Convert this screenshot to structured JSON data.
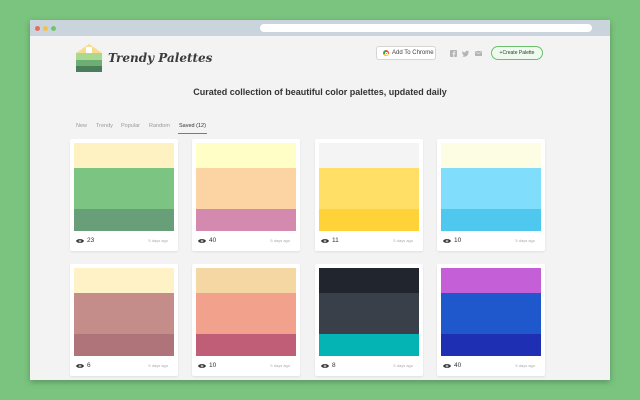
{
  "brand": {
    "name": "Trendy Palettes"
  },
  "header": {
    "chrome_button_label": "Add To Chrome",
    "create_button_label": "+Create Palette",
    "social_icons": [
      "facebook-icon",
      "twitter-icon",
      "mail-icon"
    ]
  },
  "tagline": "Curated collection of beautiful color palettes, updated daily",
  "tabs": [
    {
      "label": "New",
      "active": false
    },
    {
      "label": "Trendy",
      "active": false
    },
    {
      "label": "Popular",
      "active": false
    },
    {
      "label": "Random",
      "active": false
    },
    {
      "label": "Saved (12)",
      "active": true
    }
  ],
  "palettes": [
    {
      "colors": [
        "#fff2c2",
        "#7cc482",
        "#689e78"
      ],
      "views": "23",
      "time": "5 days ago"
    },
    {
      "colors": [
        "#fefec6",
        "#fcd3a3",
        "#d489ae"
      ],
      "views": "40",
      "time": "5 days ago"
    },
    {
      "colors": [
        "#f4f4f4",
        "#ffdf65",
        "#ffd238"
      ],
      "views": "11",
      "time": "5 days ago"
    },
    {
      "colors": [
        "#fdfde4",
        "#80ddfc",
        "#4ec8ee"
      ],
      "views": "10",
      "time": "5 days ago"
    },
    {
      "colors": [
        "#fff2c6",
        "#c48d8a",
        "#af747a"
      ],
      "views": "6",
      "time": "5 days ago"
    },
    {
      "colors": [
        "#f4d7a2",
        "#f2a18c",
        "#bf5e76"
      ],
      "views": "10",
      "time": "5 days ago"
    },
    {
      "colors": [
        "#21252d",
        "#39404a",
        "#04b4b5"
      ],
      "views": "8",
      "time": "5 days ago"
    },
    {
      "colors": [
        "#c45fd8",
        "#1f57cc",
        "#1f2fb3"
      ],
      "views": "40",
      "time": "5 days ago"
    }
  ]
}
